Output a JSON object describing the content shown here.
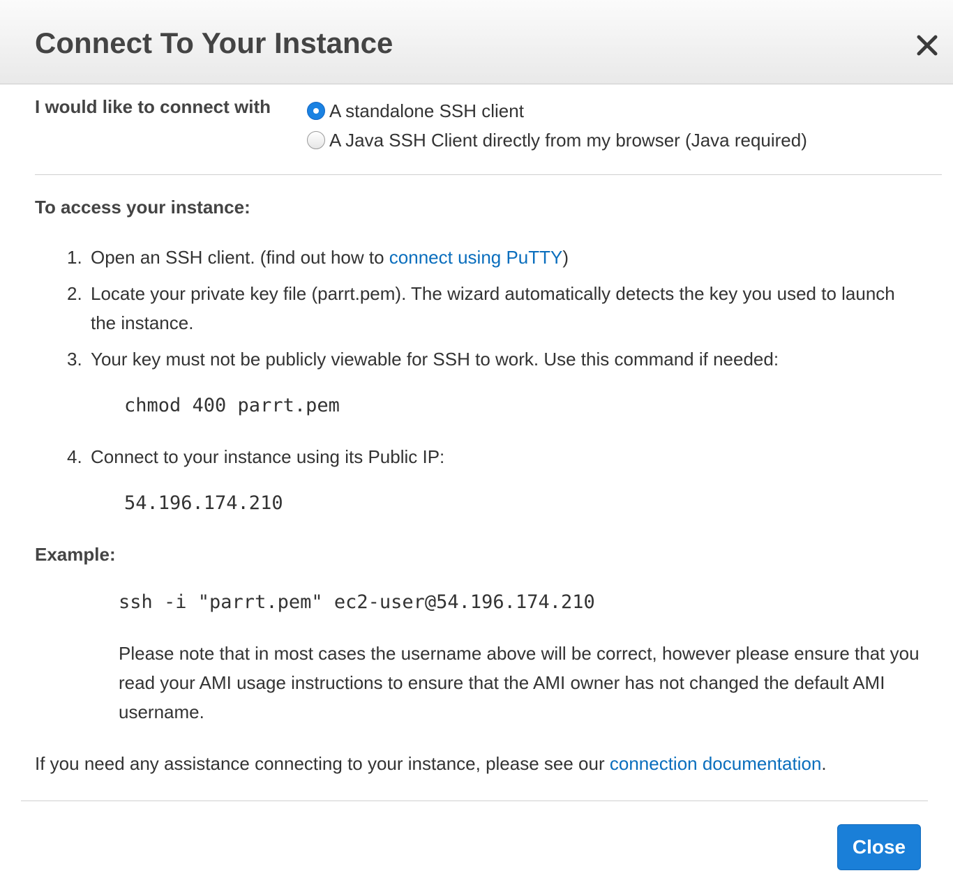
{
  "dialog": {
    "title": "Connect To Your Instance",
    "close_icon": "close-icon"
  },
  "connect": {
    "label": "I would like to connect with",
    "options": [
      {
        "label": "A standalone SSH client",
        "selected": true
      },
      {
        "label": "A Java SSH Client directly from my browser (Java required)",
        "selected": false
      }
    ]
  },
  "access": {
    "heading": "To access your instance:",
    "steps": [
      {
        "num": "1.",
        "text": "Open an SSH client. (find out how to ",
        "link": "connect using PuTTY",
        "after": ")"
      },
      {
        "num": "2.",
        "text": "Locate your private key file (parrt.pem). The wizard automatically detects the key you used to launch the instance."
      },
      {
        "num": "3.",
        "text": "Your key must not be publicly viewable for SSH to work. Use this command if needed:"
      },
      {
        "num": "4.",
        "text": "Connect to your instance using its Public IP:"
      }
    ],
    "chmod_command": "chmod 400 parrt.pem",
    "public_ip": "54.196.174.210"
  },
  "example": {
    "heading": "Example:",
    "command": "ssh -i \"parrt.pem\" ec2-user@54.196.174.210",
    "note": "Please note that in most cases the username above will be correct, however please ensure that you read your AMI usage instructions to ensure that the AMI owner has not changed the default AMI username."
  },
  "assistance": {
    "text": "If you need any assistance connecting to your instance, please see our ",
    "link": "connection documentation",
    "after": "."
  },
  "footer": {
    "close_label": "Close"
  },
  "colors": {
    "link": "#0a6ebd",
    "primary_button": "#1a7fd8",
    "radio_selected": "#1a82e2"
  }
}
